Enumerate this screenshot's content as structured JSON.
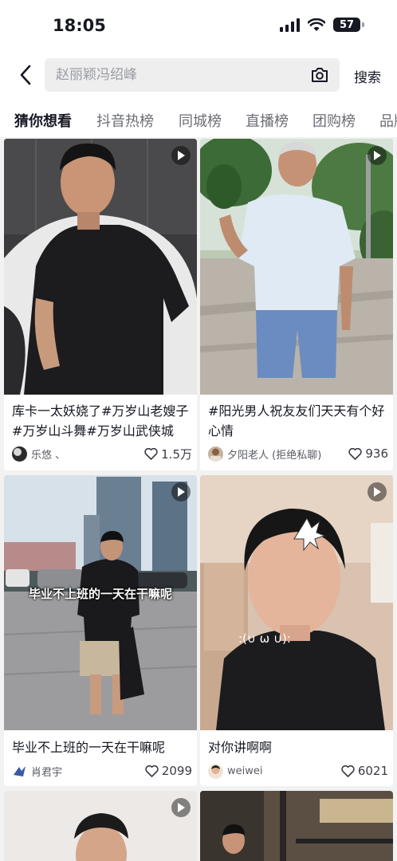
{
  "status": {
    "time": "18:05",
    "battery": "57"
  },
  "search": {
    "placeholder": "赵丽颖冯绍峰",
    "submit_label": "搜索"
  },
  "tabs": [
    {
      "label": "猜你想看",
      "active": true
    },
    {
      "label": "抖音热榜",
      "active": false
    },
    {
      "label": "同城榜",
      "active": false
    },
    {
      "label": "直播榜",
      "active": false
    },
    {
      "label": "团购榜",
      "active": false
    },
    {
      "label": "品牌",
      "active": false
    }
  ],
  "cards": [
    {
      "caption": "库卡一太妖娆了#万岁山老嫂子#万岁山斗舞#万岁山武侠城",
      "author": "乐悠 、",
      "likes": "1.5万",
      "overlay": ""
    },
    {
      "caption": "#阳光男人祝友友们天天有个好心情",
      "author": "夕阳老人 (拒绝私聊)",
      "likes": "936",
      "overlay": ""
    },
    {
      "caption": "毕业不上班的一天在干嘛呢",
      "author": "肖君宇",
      "likes": "2099",
      "overlay": "毕业不上班的一天在干嘛呢"
    },
    {
      "caption": "对你讲啊啊",
      "author": "weiwei",
      "likes": "6021",
      "overlay": ""
    },
    {
      "caption": "",
      "author": "",
      "likes": "",
      "overlay": ""
    },
    {
      "caption": "",
      "author": "",
      "likes": "",
      "overlay": ""
    }
  ],
  "icons": {
    "back": "chevron-left-icon",
    "camera": "camera-search-icon",
    "play": "play-icon",
    "like": "heart-outline-icon"
  }
}
